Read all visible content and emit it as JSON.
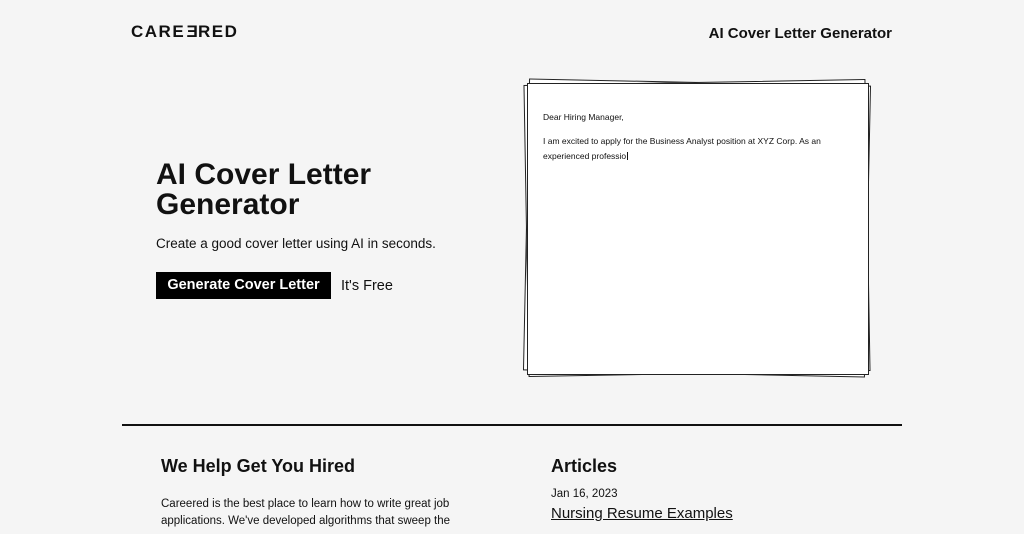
{
  "header": {
    "logo_text": "CAREERED",
    "logo_parts": {
      "before": "CARE",
      "flipped": "E",
      "after": "RED"
    },
    "nav_title": "AI Cover Letter Generator"
  },
  "hero": {
    "title": "AI Cover Letter Generator",
    "subtitle": "Create a good cover letter using AI in seconds.",
    "cta_label": "Generate Cover Letter",
    "free_label": "It's Free"
  },
  "letter": {
    "greeting": "Dear Hiring Manager,",
    "body": "I am excited to apply for the Business Analyst position at XYZ Corp. As an experienced professio"
  },
  "help": {
    "title": "We Help Get You Hired",
    "body": "Careered is the best place to learn how to write great job applications. We've developed algorithms that sweep the"
  },
  "articles": {
    "title": "Articles",
    "items": [
      {
        "date": "Jan 16, 2023",
        "title": "Nursing Resume Examples"
      }
    ]
  },
  "colors": {
    "background": "#f5f5f5",
    "text": "#111111",
    "button_bg": "#000000",
    "button_text": "#ffffff",
    "paper": "#ffffff"
  }
}
